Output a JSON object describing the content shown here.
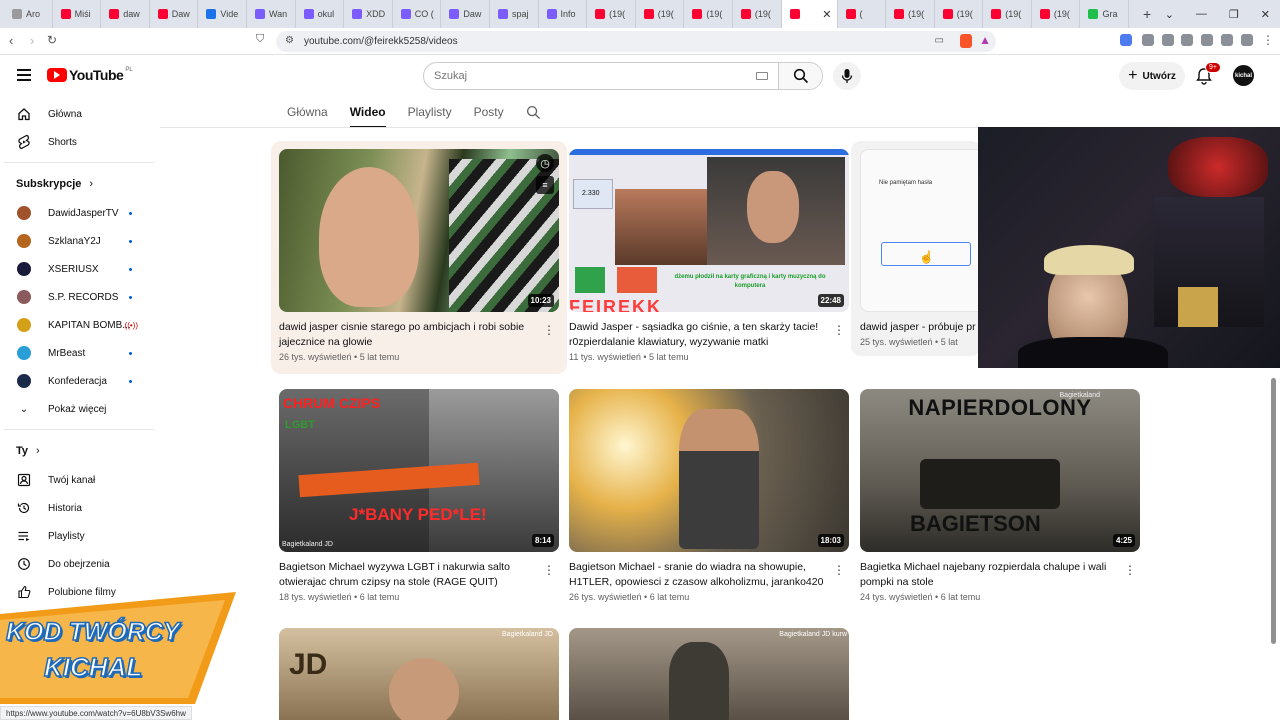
{
  "browser": {
    "tabs": [
      {
        "label": "Aro",
        "color": "#9b9b9b"
      },
      {
        "label": "Miśi",
        "color": "#ff0033"
      },
      {
        "label": "daw",
        "color": "#ff0033"
      },
      {
        "label": "Daw",
        "color": "#ff0033"
      },
      {
        "label": "Vide",
        "color": "#1a73e8"
      },
      {
        "label": "Wan",
        "color": "#7b5cff"
      },
      {
        "label": "okul",
        "color": "#7b5cff"
      },
      {
        "label": "XDD",
        "color": "#7b5cff"
      },
      {
        "label": "CO (",
        "color": "#7b5cff"
      },
      {
        "label": "Daw",
        "color": "#7b5cff"
      },
      {
        "label": "spaj",
        "color": "#7b5cff"
      },
      {
        "label": "Info",
        "color": "#7b5cff"
      },
      {
        "label": "(19(",
        "color": "#ff0033"
      },
      {
        "label": "(19(",
        "color": "#ff0033"
      },
      {
        "label": "(19(",
        "color": "#ff0033"
      },
      {
        "label": "(19(",
        "color": "#ff0033"
      },
      {
        "label": "",
        "color": "#ff0033",
        "active": true
      },
      {
        "label": "(",
        "color": "#ff0033"
      },
      {
        "label": "(19(",
        "color": "#ff0033"
      },
      {
        "label": "(19(",
        "color": "#ff0033"
      },
      {
        "label": "(19(",
        "color": "#ff0033"
      },
      {
        "label": "(19(",
        "color": "#ff0033"
      },
      {
        "label": "Gra",
        "color": "#1fbf4c"
      }
    ],
    "new_tab": "+",
    "url": "youtube.com/@feirekk5258/videos",
    "status_url": "https://www.youtube.com/watch?v=6U8bV3Sw6hw"
  },
  "header": {
    "logo_text": "YouTube",
    "logo_region": "PL",
    "search_placeholder": "Szukaj",
    "create_label": "Utwórz",
    "notif_count": "9+",
    "avatar_text": "kichal"
  },
  "sidebar": {
    "main": [
      {
        "label": "Główna",
        "icon": "home-icon"
      },
      {
        "label": "Shorts",
        "icon": "shorts-icon"
      }
    ],
    "subs_heading": "Subskrypcje",
    "subs": [
      {
        "label": "DawidJasperTV",
        "color": "#a0522d",
        "live": false
      },
      {
        "label": "SzklanaY2J",
        "color": "#b5651d",
        "live": false
      },
      {
        "label": "XSERIUSX",
        "color": "#1a1a3a",
        "live": false
      },
      {
        "label": "S.P. RECORDS",
        "color": "#8b5a5a",
        "live": false
      },
      {
        "label": "KAPITAN BOMB...",
        "color": "#d4a017",
        "live": true
      },
      {
        "label": "MrBeast",
        "color": "#2a9fd6",
        "live": false
      },
      {
        "label": "Konfederacja",
        "color": "#1b2a49",
        "live": false
      }
    ],
    "show_more": "Pokaż więcej",
    "you_heading": "Ty",
    "you": [
      {
        "label": "Twój kanał",
        "icon": "channel-icon"
      },
      {
        "label": "Historia",
        "icon": "history-icon"
      },
      {
        "label": "Playlisty",
        "icon": "playlist-icon"
      },
      {
        "label": "Do obejrzenia",
        "icon": "watch-later-icon"
      },
      {
        "label": "Polubione filmy",
        "icon": "like-icon"
      }
    ]
  },
  "channel_tabs": [
    "Główna",
    "Wideo",
    "Playlisty",
    "Posty"
  ],
  "videos": [
    {
      "title": "dawid jasper cisnie starego po ambicjach i robi sobie jajecznice na glowie",
      "views": "26 tys. wyświetleń",
      "age": "5 lat temu",
      "duration": "10:23"
    },
    {
      "title": "Dawid Jasper - sąsiadka go ciśnie, a ten skarży tacie! r0zpierdalanie klawiatury, wyzywanie matki",
      "views": "11 tys. wyświetleń",
      "age": "5 lat temu",
      "duration": "22:48"
    },
    {
      "title": "dawid jasper - próbuje pr",
      "views": "25 tys. wyświetleń",
      "age": "5 lat",
      "duration": ""
    },
    {
      "title": "Bagietson Michael wyzywa LGBT i nakurwia salto otwierajac chrum czipsy na stole (RAGE QUIT)",
      "views": "18 tys. wyświetleń",
      "age": "6 lat temu",
      "duration": "8:14"
    },
    {
      "title": "Bagietson Michael - sranie do wiadra na showupie, H1TLER, opowiesci z czasow alkoholizmu, jaranko420",
      "views": "26 tys. wyświetleń",
      "age": "6 lat temu",
      "duration": "18:03"
    },
    {
      "title": "Bagietka Michael najebany rozpierdala chalupe i wali pompki na stole",
      "views": "24 tys. wyświetleń",
      "age": "6 lat temu",
      "duration": "4:25"
    }
  ],
  "thumb_text": {
    "v2_count": "2.330",
    "v2_caption": "dżemu płodził na karty graficzną i karty muzyczną do komputera",
    "v2_banner": "FEIREKK",
    "v3_heading": "Nie pamiętam hasła",
    "v4_top": "CHRUM CZIPS",
    "v4_lgbt": "LGBT",
    "v4_bottom": "J*BANY PED*LE!",
    "v4_wm": "Bagietkaland JD",
    "v6_top": "NAPIERDOLONY",
    "v6_bottom": "BAGIETSON",
    "v6_wm": "Bagietkaland",
    "v8_wm": "Bagietkaland JD kurw",
    "v7_wm": "Bagietkaland JD",
    "v7_sign": "JD"
  },
  "separator_dot": "•",
  "badge": {
    "line1": "KOD TWÓRCY",
    "line2": "KICHAL"
  }
}
